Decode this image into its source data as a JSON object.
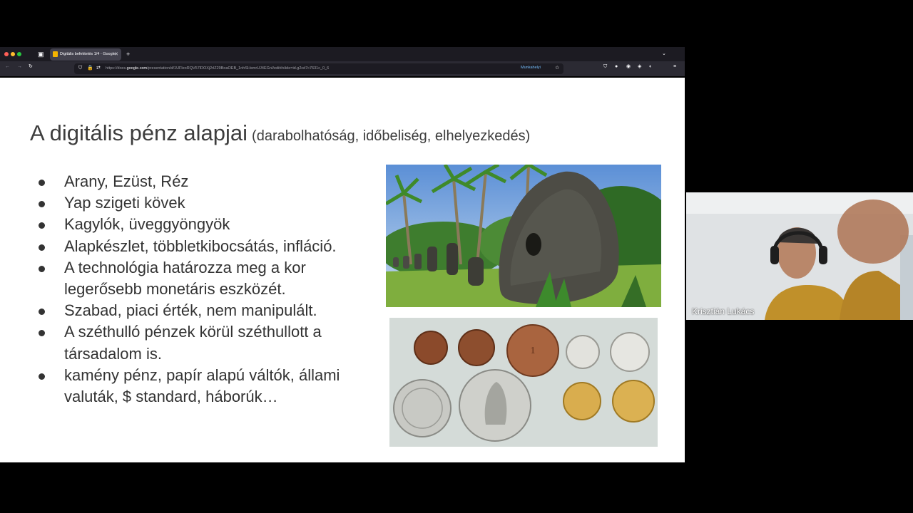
{
  "browser": {
    "tab_title": "Digitális befektetés 1/4 - Google",
    "url_prefix": "https://docs.",
    "url_domain": "google.com",
    "url_rest": "/presentation/d/1UFleoRQV57lDOXj2rlZ29BoaOEB_1nhSHsmrUJ4EGnI/edit#slide=id.g2cd7c7631c_0_6",
    "workplace_label": "Munkahelyi",
    "colors": {
      "close": "#ff5f57",
      "minimize": "#febc2e",
      "maximize": "#28c840"
    }
  },
  "slide": {
    "title": "A digitális pénz alapjai",
    "subtitle": "(darabolhatóság, időbeliség, elhelyezkedés)",
    "bullets": [
      "Arany, Ezüst, Réz",
      "Yap szigeti kövek",
      "Kagylók, üveggyöngyök",
      "Alapkészlet, többletkibocsátás, infláció.",
      "A technológia határozza meg a kor legerősebb monetáris eszközét.",
      "Szabad, piaci érték, nem manipulált.",
      "A széthulló pénzek körül széthullott a társadalom is.",
      "kamény pénz, papír alapú váltók, állami valuták, $ standard, háborúk…"
    ]
  },
  "webcam": {
    "participant_name": "Krisztián Lukács"
  }
}
